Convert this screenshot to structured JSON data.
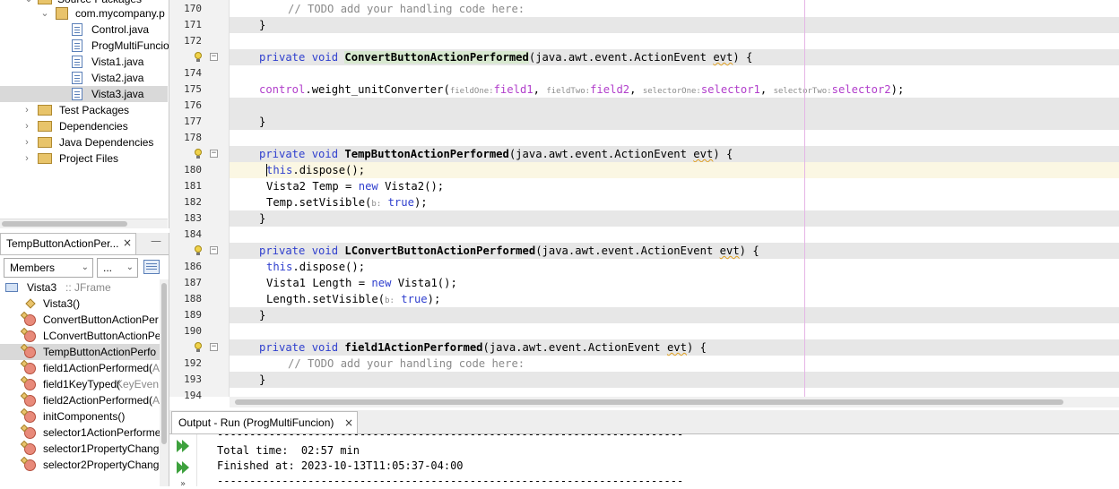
{
  "project_tree": {
    "items": [
      {
        "label": "Source Packages",
        "kind": "folder"
      },
      {
        "label": "com.mycompany.p",
        "kind": "package"
      },
      {
        "label": "Control.java",
        "kind": "file"
      },
      {
        "label": "ProgMultiFuncio",
        "kind": "file"
      },
      {
        "label": "Vista1.java",
        "kind": "file"
      },
      {
        "label": "Vista2.java",
        "kind": "file"
      },
      {
        "label": "Vista3.java",
        "kind": "file",
        "selected": true
      },
      {
        "label": "Test Packages",
        "kind": "folder"
      },
      {
        "label": "Dependencies",
        "kind": "folder"
      },
      {
        "label": "Java Dependencies",
        "kind": "folder"
      },
      {
        "label": "Project Files",
        "kind": "folder"
      }
    ]
  },
  "navigator": {
    "tab_title": "TempButtonActionPer...",
    "close": "×",
    "minimize": "—",
    "filter_selected": "Members",
    "filter2_selected": "...",
    "root_label": "Vista3",
    "root_type": ":: JFrame",
    "members": [
      {
        "name": "Vista3()",
        "extra": ""
      },
      {
        "name": "ConvertButtonActionPer",
        "extra": ""
      },
      {
        "name": "LConvertButtonActionPe",
        "extra": ""
      },
      {
        "name": "TempButtonActionPerfo",
        "extra": ""
      },
      {
        "name": "field1ActionPerformed(",
        "extra": "A"
      },
      {
        "name": "field1KeyTyped(",
        "extra": "KeyEven"
      },
      {
        "name": "field2ActionPerformed(",
        "extra": "A"
      },
      {
        "name": "initComponents()",
        "extra": ""
      },
      {
        "name": "selector1ActionPerforme",
        "extra": ""
      },
      {
        "name": "selector1PropertyChange",
        "extra": ""
      },
      {
        "name": "selector2PropertyChange",
        "extra": ""
      }
    ]
  },
  "editor": {
    "line_numbers": [
      "170",
      "171",
      "172",
      "",
      "174",
      "175",
      "176",
      "177",
      "178",
      "",
      "180",
      "181",
      "182",
      "183",
      "184",
      "",
      "186",
      "187",
      "188",
      "189",
      "190",
      "",
      "192",
      "193",
      "194"
    ],
    "lines": {
      "l170": "// TODO add your handling code here:",
      "l171": "}",
      "l173_kw": "private void",
      "l173_fn": "ConvertButtonActionPerformed",
      "l173_rest_a": "(java.awt.event.ActionEvent ",
      "l173_evt": "evt",
      "l173_rest_b": ") {",
      "l175_a": "control",
      "l175_b": ".weight_unitConverter(",
      "l175_h1": "fieldOne:",
      "l175_f1": "field1",
      "l175_h2": "fieldTwo:",
      "l175_f2": "field2",
      "l175_h3": "selectorOne:",
      "l175_f3": "selector1",
      "l175_h4": "selectorTwo:",
      "l175_f4": "selector2",
      "l175_end": ");",
      "l177": "}",
      "l179_kw": "private void",
      "l179_fn": "TempButtonActionPerformed",
      "l179_rest_a": "(java.awt.event.ActionEvent ",
      "l179_evt": "evt",
      "l179_rest_b": ") {",
      "l180_kw": "this",
      "l180_rest": ".dispose();",
      "l181_a": "Vista2 Temp = ",
      "l181_kw": "new",
      "l181_b": " Vista2();",
      "l182_a": "Temp.setVisible(",
      "l182_hint": "b:",
      "l182_kw": "true",
      "l182_end": ");",
      "l183": "}",
      "l185_kw": "private void",
      "l185_fn": "LConvertButtonActionPerformed",
      "l185_rest_a": "(java.awt.event.ActionEvent ",
      "l185_evt": "evt",
      "l185_rest_b": ") {",
      "l186_kw": "this",
      "l186_rest": ".dispose();",
      "l187_a": "Vista1 Length = ",
      "l187_kw": "new",
      "l187_b": " Vista1();",
      "l188_a": "Length.setVisible(",
      "l188_hint": "b:",
      "l188_kw": "true",
      "l188_end": ");",
      "l189": "}",
      "l191_kw": "private void",
      "l191_fn": "field1ActionPerformed",
      "l191_rest_a": "(java.awt.event.ActionEvent ",
      "l191_evt": "evt",
      "l191_rest_b": ") {",
      "l192": "// TODO add your handling code here:",
      "l193": "}"
    }
  },
  "output": {
    "tab_title": "Output - Run (ProgMultiFuncion)",
    "close": "×",
    "lines": [
      "------------------------------------------------------------------------",
      "Total time:  02:57 min",
      "Finished at: 2023-10-13T11:05:37-04:00",
      "------------------------------------------------------------------------"
    ]
  },
  "colors": {
    "keyword": "#2f3fce",
    "field": "#b13ecb",
    "comment": "#8a8a8a",
    "run_icon": "#3da13d",
    "selection": "#d9d9d9"
  }
}
